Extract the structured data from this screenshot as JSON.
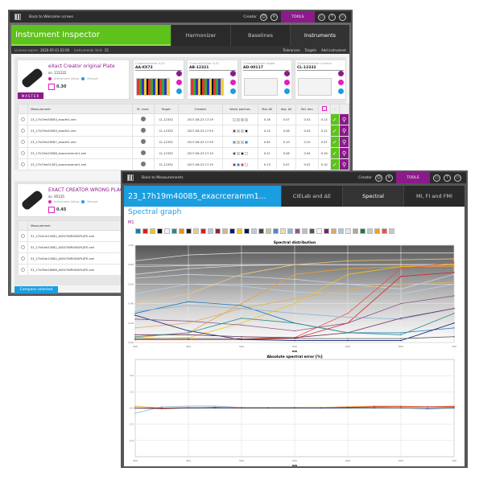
{
  "inspector": {
    "topbar": {
      "back": "Back to Welcome screen",
      "user": "Creator",
      "tools": "TOOLS"
    },
    "title": "Instrument Inspector",
    "tabs": [
      {
        "label": "Harmonizer"
      },
      {
        "label": "Baselines"
      },
      {
        "label": "Instruments",
        "active": true
      }
    ],
    "license": {
      "label": "License expire:",
      "value": "2020-05-01 02:00",
      "limit_label": "Instruments limit:",
      "limit_value": "15"
    },
    "actions": [
      "Tolerances",
      "Targets",
      "Add instrument"
    ],
    "accent": "#5ec21c",
    "instrument1": {
      "name": "eXact Creator original Plate",
      "sn": "sn. 111222",
      "setup": "Instrument Setup",
      "manual": "Manual",
      "score": "0.30",
      "badge": "MASTER",
      "targets": [
        {
          "type": "ChromaChecker X-42",
          "id": "AA-XX73"
        },
        {
          "type": "ChromaChecker X-42",
          "id": "AB-12321"
        },
        {
          "type": "ChromaChecker target",
          "id": "AD-00117"
        },
        {
          "type": "ChromaChecker Luckton",
          "id": "CL-12332"
        }
      ]
    },
    "table_headers": [
      "Measurement",
      "M. cond.",
      "Target",
      "Created",
      "Worst patches",
      "Max ΔE",
      "Avg. ΔE",
      "Std. dev.",
      "",
      ""
    ],
    "rows": [
      {
        "file": "23_17h29m58563_exacfe1.xml",
        "target": "CL-12332",
        "created": "2017-08-23 17:29",
        "max": "0.16",
        "avg": "0.07",
        "std": "0.03",
        "score": "0.13",
        "patches": [
          "#eeeeee",
          "#cccccc",
          "#bbbbbb",
          "#c9d4dc"
        ]
      },
      {
        "file": "23_17h29m40563_exacfe1.xml",
        "target": "CL-12332",
        "created": "2017-08-23 17:29",
        "max": "0.15",
        "avg": "0.06",
        "std": "0.03",
        "score": "0.12",
        "patches": [
          "#6a2a5a",
          "#c0c0c0",
          "#b4c8d8",
          "#111111"
        ]
      },
      {
        "file": "23_17h29m28587_exacfe1.xml",
        "target": "CL-12332",
        "created": "2017-08-23 17:29",
        "max": "0.40",
        "avg": "0.19",
        "std": "0.10",
        "score": "0.37",
        "patches": [
          "#4a9ac8",
          "#d8c890",
          "#c0c8cc",
          "#1a78b8"
        ]
      },
      {
        "file": "23_17h19m20588_exacrceramm1.xml",
        "target": "CL-12332",
        "created": "2017-08-23 17:19",
        "max": "0.21",
        "avg": "0.08",
        "std": "0.04",
        "score": "0.16",
        "patches": [
          "#6a2a5a",
          "#c8c8c8",
          "#111111",
          "#ffffff"
        ]
      },
      {
        "file": "23_17h19m01283_exacrceramm1.xml",
        "target": "CL-12332",
        "created": "2017-08-23 17:19",
        "max": "0.13",
        "avg": "0.07",
        "std": "0.02",
        "score": "0.10",
        "patches": [
          "#6a2a5a",
          "#1a78b8",
          "#d83030",
          "#ffffff"
        ]
      }
    ],
    "instrument2": {
      "name": "EXACT CREATOR WRONG PLAQUE",
      "sn": "sn. 95135",
      "setup": "Instrument Setup",
      "manual": "Manual",
      "score": "0.45"
    },
    "rows2": [
      "31_17h41m15582_A0007WRONGPLATE.xml",
      "31_17h40m53082_A0007WRONGPLATE.xml",
      "31_17h40m10082_A0007WRONGPLATE.xml",
      "31_17h39m28088_A0007WRONGPLATE.xml"
    ],
    "compare": "Compare selected"
  },
  "spectral": {
    "topbar": {
      "back": "Back to Measurements",
      "user": "Creator",
      "tools": "TOOLS"
    },
    "title": "23_17h19m40085_exacrceramm1...",
    "tabs": [
      {
        "label": "CIELab and ΔE"
      },
      {
        "label": "Spectral",
        "active": true
      },
      {
        "label": "MI, FI and FMI"
      }
    ],
    "accent": "#1a9ee0",
    "heading": "Spectral graph",
    "measure": "M1",
    "swatches": [
      "#1a78b8",
      "#d81e1e",
      "#f5c518",
      "#111111",
      "#f0f4f8",
      "#2a8a8a",
      "#f08c1e",
      "#222222",
      "#e8c8a0",
      "#d81e1e",
      "#b8c8d8",
      "#8a2a2a",
      "#e0b090",
      "#0a1a6a",
      "#f5c518",
      "#0a1a3a",
      "#c0c8d0",
      "#444444",
      "#c8c890",
      "#4a8ac8",
      "#f0e0b0",
      "#8ab8d8",
      "#8a5a8a",
      "#c0c0c0",
      "#555555",
      "#f8f8f8",
      "#6a2a6a",
      "#d8a870",
      "#a8c8e0",
      "#e8e8e8",
      "#a8a8a0",
      "#1a7a4a",
      "#c8c8c8",
      "#f0a030",
      "#e85050",
      "#c8c8c8"
    ],
    "chart_data": [
      {
        "type": "line",
        "title": "Spectral distribution",
        "xlabel": "nm",
        "ylabel": "",
        "xlim": [
          400,
          700
        ],
        "ylim": [
          0,
          1
        ],
        "xticks": [
          400,
          450,
          500,
          550,
          600,
          650,
          700
        ],
        "yticks": [
          "0.00",
          "0.20",
          "0.40",
          "0.60",
          "0.80",
          "1.00"
        ],
        "grid": true,
        "x": [
          400,
          450,
          500,
          550,
          600,
          650,
          700
        ],
        "series": [
          {
            "color": "#dddddd",
            "values": [
              0.84,
              0.9,
              0.92,
              0.92,
              0.92,
              0.92,
              0.92
            ]
          },
          {
            "color": "#e0e0e0",
            "values": [
              0.78,
              0.79,
              0.8,
              0.8,
              0.8,
              0.8,
              0.8
            ]
          },
          {
            "color": "#d8d8d8",
            "values": [
              0.7,
              0.76,
              0.79,
              0.8,
              0.8,
              0.8,
              0.8
            ]
          },
          {
            "color": "#c8d8e8",
            "values": [
              0.66,
              0.7,
              0.68,
              0.65,
              0.6,
              0.55,
              0.7
            ]
          },
          {
            "color": "#b8d0e8",
            "values": [
              0.5,
              0.6,
              0.58,
              0.52,
              0.5,
              0.5,
              0.6
            ]
          },
          {
            "color": "#f0c880",
            "values": [
              0.4,
              0.5,
              0.7,
              0.8,
              0.84,
              0.85,
              0.86
            ]
          },
          {
            "color": "#f0a030",
            "values": [
              0.05,
              0.1,
              0.4,
              0.7,
              0.76,
              0.78,
              0.78
            ]
          },
          {
            "color": "#f5c518",
            "values": [
              0.03,
              0.05,
              0.2,
              0.4,
              0.7,
              0.78,
              0.8
            ]
          },
          {
            "color": "#e0b060",
            "values": [
              0.15,
              0.2,
              0.35,
              0.45,
              0.55,
              0.6,
              0.62
            ]
          },
          {
            "color": "#d81e1e",
            "values": [
              0.03,
              0.03,
              0.03,
              0.04,
              0.2,
              0.68,
              0.72
            ]
          },
          {
            "color": "#e85050",
            "values": [
              0.04,
              0.04,
              0.04,
              0.05,
              0.3,
              0.76,
              0.82
            ]
          },
          {
            "color": "#1a78b8",
            "values": [
              0.3,
              0.42,
              0.38,
              0.2,
              0.1,
              0.1,
              0.15
            ]
          },
          {
            "color": "#8ab8d8",
            "values": [
              0.32,
              0.38,
              0.35,
              0.3,
              0.26,
              0.24,
              0.35
            ]
          },
          {
            "color": "#0a1a6a",
            "values": [
              0.28,
              0.12,
              0.03,
              0.02,
              0.02,
              0.02,
              0.2
            ]
          },
          {
            "color": "#8a5a8a",
            "values": [
              0.24,
              0.22,
              0.18,
              0.12,
              0.2,
              0.4,
              0.48
            ]
          },
          {
            "color": "#6a2a5a",
            "values": [
              0.08,
              0.08,
              0.06,
              0.05,
              0.1,
              0.25,
              0.35
            ]
          },
          {
            "color": "#2a8a8a",
            "values": [
              0.06,
              0.1,
              0.25,
              0.2,
              0.1,
              0.08,
              0.3
            ]
          },
          {
            "color": "#555555",
            "values": [
              0.04,
              0.04,
              0.04,
              0.04,
              0.04,
              0.04,
              0.06
            ]
          }
        ]
      },
      {
        "type": "line",
        "title": "Absolute spectral error [%]",
        "xlabel": "nm",
        "ylabel": "",
        "xlim": [
          400,
          700
        ],
        "ylim": [
          -7.5,
          7.5
        ],
        "xticks": [
          400,
          450,
          500,
          550,
          600,
          650,
          700
        ],
        "yticks": [
          "5.0",
          "2.5",
          "0.0",
          "-2.5",
          "-5.0"
        ],
        "grid": true,
        "x": [
          400,
          425,
          450,
          475,
          500,
          525,
          550,
          575,
          600,
          625,
          650,
          675,
          700
        ],
        "series": [
          {
            "color": "#8ab8d8",
            "values": [
              -0.8,
              0.2,
              0.3,
              0.3,
              0.1,
              0.1,
              0.1,
              0,
              0,
              0.1,
              0.2,
              0.1,
              0.1
            ]
          },
          {
            "color": "#f0a030",
            "values": [
              0.3,
              0,
              0.1,
              0,
              0.1,
              0,
              0.1,
              0.1,
              0.2,
              0.3,
              0.3,
              0.2,
              0.3
            ]
          },
          {
            "color": "#d81e1e",
            "values": [
              0,
              -0.1,
              0,
              0.1,
              0,
              0,
              0,
              0,
              0.1,
              0.2,
              0.2,
              0.2,
              0.2
            ]
          },
          {
            "color": "#1a3a5a",
            "values": [
              0,
              0,
              0,
              0,
              0,
              0,
              0,
              0,
              0,
              0,
              0,
              -0.1,
              0
            ]
          }
        ]
      }
    ]
  }
}
